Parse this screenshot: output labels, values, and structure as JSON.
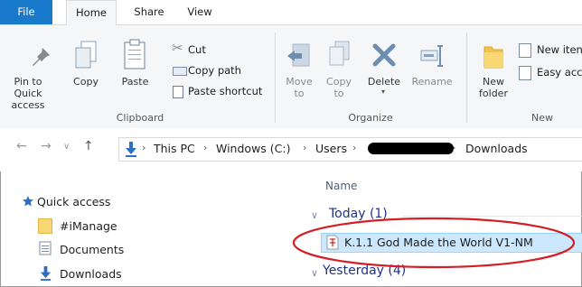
{
  "tabs": [
    "File",
    "Home",
    "Share",
    "View"
  ],
  "ribbon": {
    "pin_label": "Pin to Quick access",
    "copy_label": "Copy",
    "paste_label": "Paste",
    "cut_label": "Cut",
    "copy_path_label": "Copy path",
    "paste_shortcut_label": "Paste shortcut",
    "clipboard_group": "Clipboard",
    "move_to_label": "Move to",
    "copy_to_label": "Copy to",
    "delete_label": "Delete",
    "rename_label": "Rename",
    "organize_group": "Organize",
    "new_folder_label": "New folder",
    "new_item_label": "New iten",
    "easy_access_label": "Easy acc",
    "new_group": "New"
  },
  "address": {
    "crumbs": [
      "This PC",
      "Windows (C:)",
      "Users",
      "Downloads"
    ]
  },
  "sidebar": {
    "items": [
      "Quick access",
      "#iManage",
      "Documents",
      "Downloads"
    ]
  },
  "content": {
    "column_name": "Name",
    "group_today": "Today (1)",
    "file_name": "K.1.1 God Made the World V1-NM",
    "group_yesterday": "Yesterday (4)"
  },
  "colors": {
    "accent": "#1979ca",
    "annotation": "#d21e24",
    "selection": "#cce8ff"
  }
}
